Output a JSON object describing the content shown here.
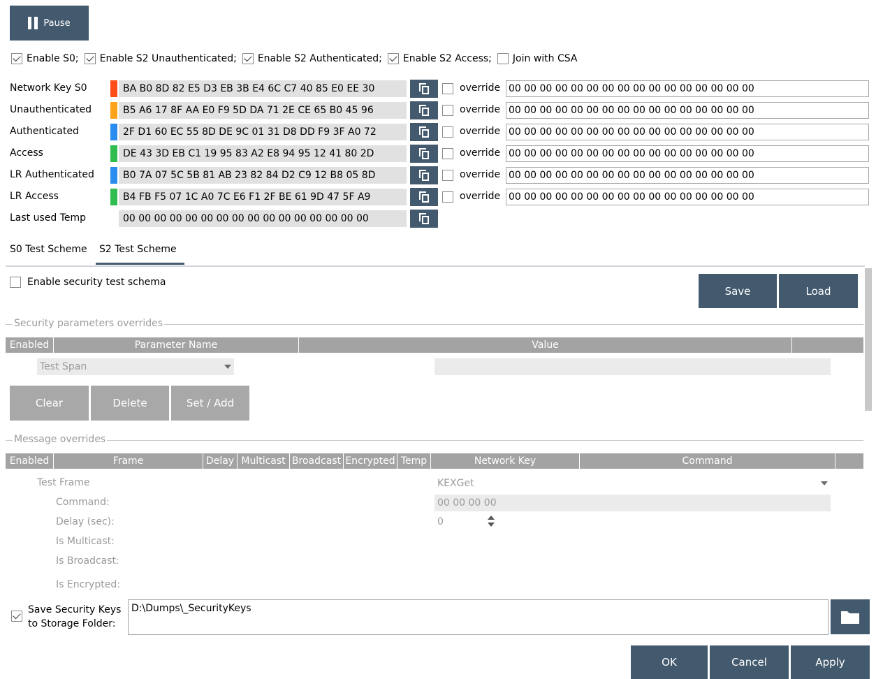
{
  "toolbar": {
    "pause_label": "Pause"
  },
  "flags": [
    {
      "label": "Enable S0;",
      "checked": true
    },
    {
      "label": "Enable S2 Unauthenticated;",
      "checked": true
    },
    {
      "label": "Enable S2 Authenticated;",
      "checked": true
    },
    {
      "label": "Enable S2 Access;",
      "checked": true
    },
    {
      "label": "Join with CSA",
      "checked": false
    }
  ],
  "keys": [
    {
      "label": "Network Key S0",
      "color": "#ff4d1a",
      "value": "BA B0 8D 82 E5 D3 EB 3B E4 6C C7 40 85 E0 EE 30",
      "override_label": "override",
      "override_value": "00 00 00 00 00 00 00 00 00 00 00 00 00 00 00 00"
    },
    {
      "label": "Unauthenticated",
      "color": "#ffa31a",
      "value": "B5 A6 17 8F AA E0 F9 5D DA 71 2E CE 65 B0 45 96",
      "override_label": "override",
      "override_value": "00 00 00 00 00 00 00 00 00 00 00 00 00 00 00 00"
    },
    {
      "label": "Authenticated",
      "color": "#2b8cf0",
      "value": "2F D1 60 EC 55 8D DE 9C 01 31 D8 DD F9 3F A0 72",
      "override_label": "override",
      "override_value": "00 00 00 00 00 00 00 00 00 00 00 00 00 00 00 00"
    },
    {
      "label": "Access",
      "color": "#2ebd4e",
      "value": "DE 43 3D EB C1 19 95 83 A2 E8 94 95 12 41 80 2D",
      "override_label": "override",
      "override_value": "00 00 00 00 00 00 00 00 00 00 00 00 00 00 00 00"
    },
    {
      "label": "LR Authenticated",
      "color": "#2b8cf0",
      "value": "B0 7A 07 5C 5B 81 AB 23 82 84 D2 C9 12 B8 05 8D",
      "override_label": "override",
      "override_value": "00 00 00 00 00 00 00 00 00 00 00 00 00 00 00 00"
    },
    {
      "label": "LR Access",
      "color": "#2ebd4e",
      "value": "B4 FB F5 07 1C A0 7C E6 F1 2F BE 61 9D 47 5F A9",
      "override_label": "override",
      "override_value": "00 00 00 00 00 00 00 00 00 00 00 00 00 00 00 00"
    },
    {
      "label": "Last used Temp",
      "color": "",
      "value": "00 00 00 00 00 00 00 00 00 00 00 00 00 00 00 00"
    }
  ],
  "tabs": [
    {
      "label": "S0 Test Scheme",
      "active": false
    },
    {
      "label": "S2 Test Scheme",
      "active": true
    }
  ],
  "schema": {
    "enable_label": "Enable security test schema",
    "enable_checked": false,
    "save_label": "Save",
    "load_label": "Load"
  },
  "params": {
    "group_title": "Security parameters overrides",
    "columns": [
      "Enabled",
      "Parameter Name",
      "Value"
    ],
    "selected": "Test Span",
    "value": "",
    "clear_label": "Clear",
    "delete_label": "Delete",
    "set_add_label": "Set / Add"
  },
  "messages": {
    "group_title": "Message overrides",
    "columns": [
      "Enabled",
      "Frame",
      "Delay",
      "Multicast",
      "Broadcast",
      "Encrypted",
      "Temp",
      "Network Key",
      "Command"
    ],
    "test_frame_label": "Test Frame",
    "test_frame_value": "KEXGet",
    "command_label": "Command:",
    "command_value": "00 00 00 00",
    "delay_label": "Delay (sec):",
    "delay_value": "0",
    "multicast_label": "Is Multicast:",
    "broadcast_label": "Is Broadcast:",
    "encrypted_label": "Is Encrypted:"
  },
  "storage": {
    "label_line1": "Save Security Keys",
    "label_line2": "to Storage Folder:",
    "checked": true,
    "path": "D:\\Dumps\\_SecurityKeys"
  },
  "footer": {
    "ok_label": "OK",
    "cancel_label": "Cancel",
    "apply_label": "Apply"
  },
  "colors": {
    "accent": "#435a6e",
    "disabled_button": "#a8a8a8",
    "table_header": "#a3a3a3"
  }
}
